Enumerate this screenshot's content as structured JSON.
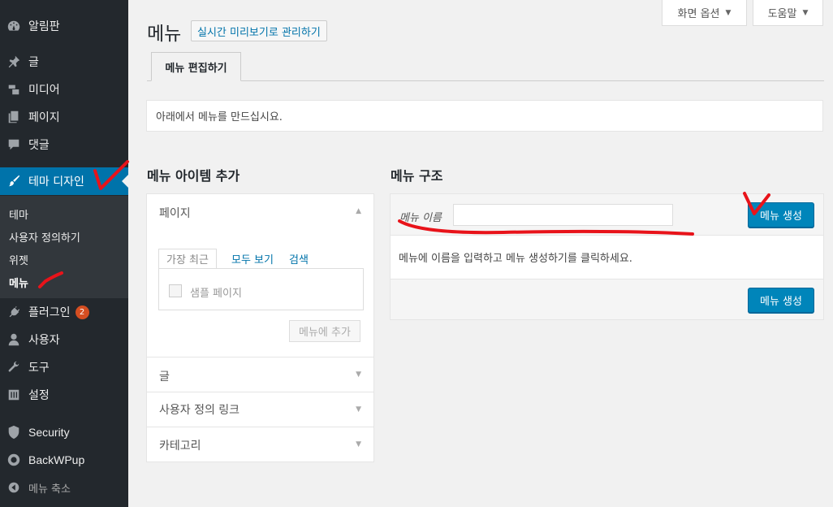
{
  "sidebar": {
    "items": [
      {
        "label": "알림판",
        "icon": "dashboard-icon"
      },
      {
        "label": "글",
        "icon": "pushpin-icon"
      },
      {
        "label": "미디어",
        "icon": "media-icon"
      },
      {
        "label": "페이지",
        "icon": "pages-icon"
      },
      {
        "label": "댓글",
        "icon": "comments-icon"
      },
      {
        "label": "테마 디자인",
        "icon": "paintbrush-icon"
      },
      {
        "label": "플러그인",
        "icon": "plugin-icon",
        "badge": "2"
      },
      {
        "label": "사용자",
        "icon": "user-icon"
      },
      {
        "label": "도구",
        "icon": "wrench-icon"
      },
      {
        "label": "설정",
        "icon": "settings-icon"
      },
      {
        "label": "Security",
        "icon": "shield-icon"
      },
      {
        "label": "BackWPup",
        "icon": "backwpup-icon"
      },
      {
        "label": "메뉴 축소",
        "icon": "collapse-icon"
      }
    ],
    "submenu": [
      "테마",
      "사용자 정의하기",
      "위젯",
      "메뉴"
    ]
  },
  "screen_options": {
    "label": "화면 옵션"
  },
  "help": {
    "label": "도움말"
  },
  "page": {
    "title": "메뉴",
    "live_preview": "실시간 미리보기로 관리하기",
    "tab_edit": "메뉴 편집하기",
    "notice": "아래에서 메뉴를 만드십시요."
  },
  "add_items": {
    "heading": "메뉴 아이템 추가",
    "sections": [
      "페이지",
      "글",
      "사용자 정의 링크",
      "카테고리"
    ],
    "tabs": [
      "가장 최근",
      "모두 보기",
      "검색"
    ],
    "sample_page": "샘플 페이지",
    "add_button": "메뉴에 추가"
  },
  "structure": {
    "heading": "메뉴 구조",
    "name_label": "메뉴 이름",
    "name_value": "",
    "create_button": "메뉴 생성",
    "instruction": "메뉴에 이름을 입력하고 메뉴 생성하기를 클릭하세요."
  },
  "colors": {
    "accent": "#0073aa",
    "sidebar": "#23282d",
    "annotation": "#ff0000"
  }
}
